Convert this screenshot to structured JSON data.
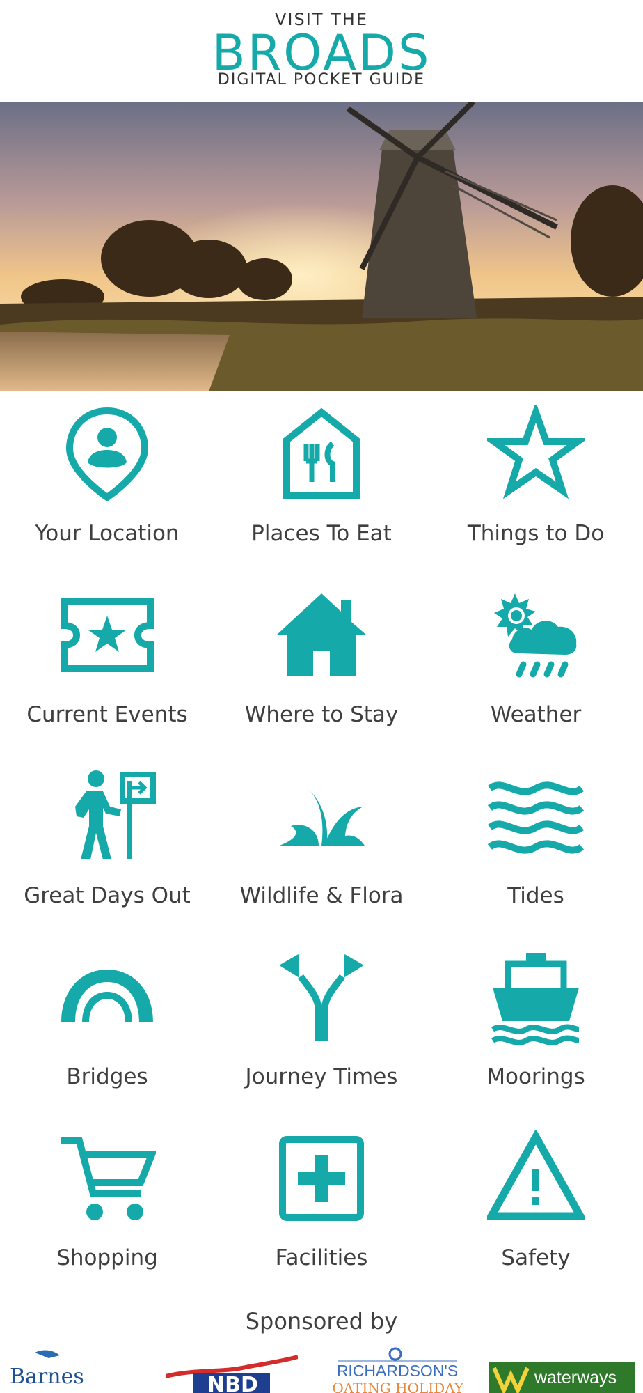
{
  "header": {
    "line1": "VISIT THE",
    "line2": "BROADS",
    "line3": "DIGITAL POCKET GUIDE"
  },
  "colors": {
    "accent": "#16a9a9",
    "text": "#3f3f3f"
  },
  "menu": [
    {
      "label": "Your Location",
      "icon": "location-pin-person-icon"
    },
    {
      "label": "Places To Eat",
      "icon": "restaurant-house-icon"
    },
    {
      "label": "Things to Do",
      "icon": "star-icon"
    },
    {
      "label": "Current Events",
      "icon": "ticket-star-icon"
    },
    {
      "label": "Where to Stay",
      "icon": "house-icon"
    },
    {
      "label": "Weather",
      "icon": "sun-cloud-rain-icon"
    },
    {
      "label": "Great Days Out",
      "icon": "hiker-signpost-icon"
    },
    {
      "label": "Wildlife & Flora",
      "icon": "reeds-icon"
    },
    {
      "label": "Tides",
      "icon": "waves-icon"
    },
    {
      "label": "Bridges",
      "icon": "bridge-arch-icon"
    },
    {
      "label": "Journey Times",
      "icon": "fork-arrows-icon"
    },
    {
      "label": "Moorings",
      "icon": "boat-icon"
    },
    {
      "label": "Shopping",
      "icon": "shopping-cart-icon"
    },
    {
      "label": "Facilities",
      "icon": "first-aid-box-icon"
    },
    {
      "label": "Safety",
      "icon": "warning-triangle-icon"
    }
  ],
  "sponsors": {
    "heading": "Sponsored by",
    "names": [
      "Barnes",
      "NBD",
      "RICHARDSON'S",
      "BOATING HOLIDAYS",
      "waterways"
    ]
  }
}
